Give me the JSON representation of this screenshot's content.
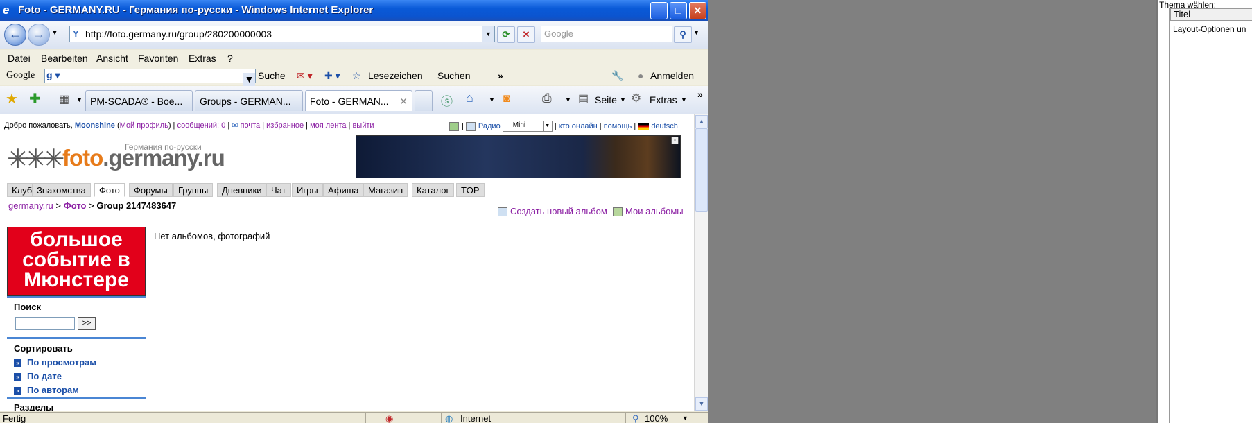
{
  "window": {
    "title": "Foto - GERMANY.RU - Германия по-русски - Windows Internet Explorer",
    "minimize": "_",
    "maximize": "□",
    "close": "✕"
  },
  "address": {
    "url": "http://foto.germany.ru/group/280200000003",
    "search_placeholder": "Google"
  },
  "menu": [
    "Datei",
    "Bearbeiten",
    "Ansicht",
    "Favoriten",
    "Extras",
    "?"
  ],
  "google_bar": {
    "logo": "Google",
    "search_label": "Suche",
    "bookmarks": "Lesezeichen",
    "suchen": "Suchen",
    "more": "»",
    "anmelden": "Anmelden"
  },
  "tabs": [
    {
      "label": "PM-SCADA® - Boe..."
    },
    {
      "label": "Groups - GERMAN..."
    },
    {
      "label": "Foto - GERMAN..."
    }
  ],
  "toolbar": {
    "seite": "Seite",
    "extras": "Extras"
  },
  "page": {
    "welcome": "Добро пожаловать,",
    "user": "Moonshine",
    "profile": "Мой профиль",
    "messages": "сообщений: 0",
    "mail": "почта",
    "favorites": "избранное",
    "feed": "моя лента",
    "logout": "выйти",
    "radio": "Радио",
    "mini": "Mini",
    "online": "кто онлайн",
    "help": "помощь",
    "lang": "deutsch",
    "logo_sub": "Германия по-русски",
    "logo_main": "foto",
    "logo_domain": ".germany.ru",
    "nav": [
      "Клуб",
      "Знакомства",
      "Фото",
      "Форумы",
      "Группы",
      "Дневники",
      "Чат",
      "Игры",
      "Афиша",
      "Магазин",
      "Каталог",
      "TOP"
    ],
    "active_nav": "Фото",
    "crumb_site": "germany.ru",
    "crumb_sep1": ">",
    "crumb_foto": "Фото",
    "crumb_sep2": ">",
    "crumb_group": "Group 2147483647",
    "create_album": "Создать новый альбом",
    "my_albums": "Мои альбомы",
    "promo": "большое событие в Мюнстере",
    "search_heading": "Поиск",
    "search_button": ">>",
    "sort_heading": "Сортировать",
    "sort_items": [
      "По просмотрам",
      "По дате",
      "По авторам"
    ],
    "sections_heading": "Разделы",
    "empty": "Нет альбомов, фотографий"
  },
  "status": {
    "text": "Fertig",
    "zone": "Internet",
    "zoom": "100%"
  },
  "right_panel": {
    "header": "Thema wählen:",
    "col": "Titel",
    "row": "Layout-Optionen un"
  },
  "colors": {
    "titlebar": "#0b54cf",
    "link_purple": "#8b1fa3",
    "link_blue": "#1b4fa8",
    "promo_red": "#e2001a"
  }
}
